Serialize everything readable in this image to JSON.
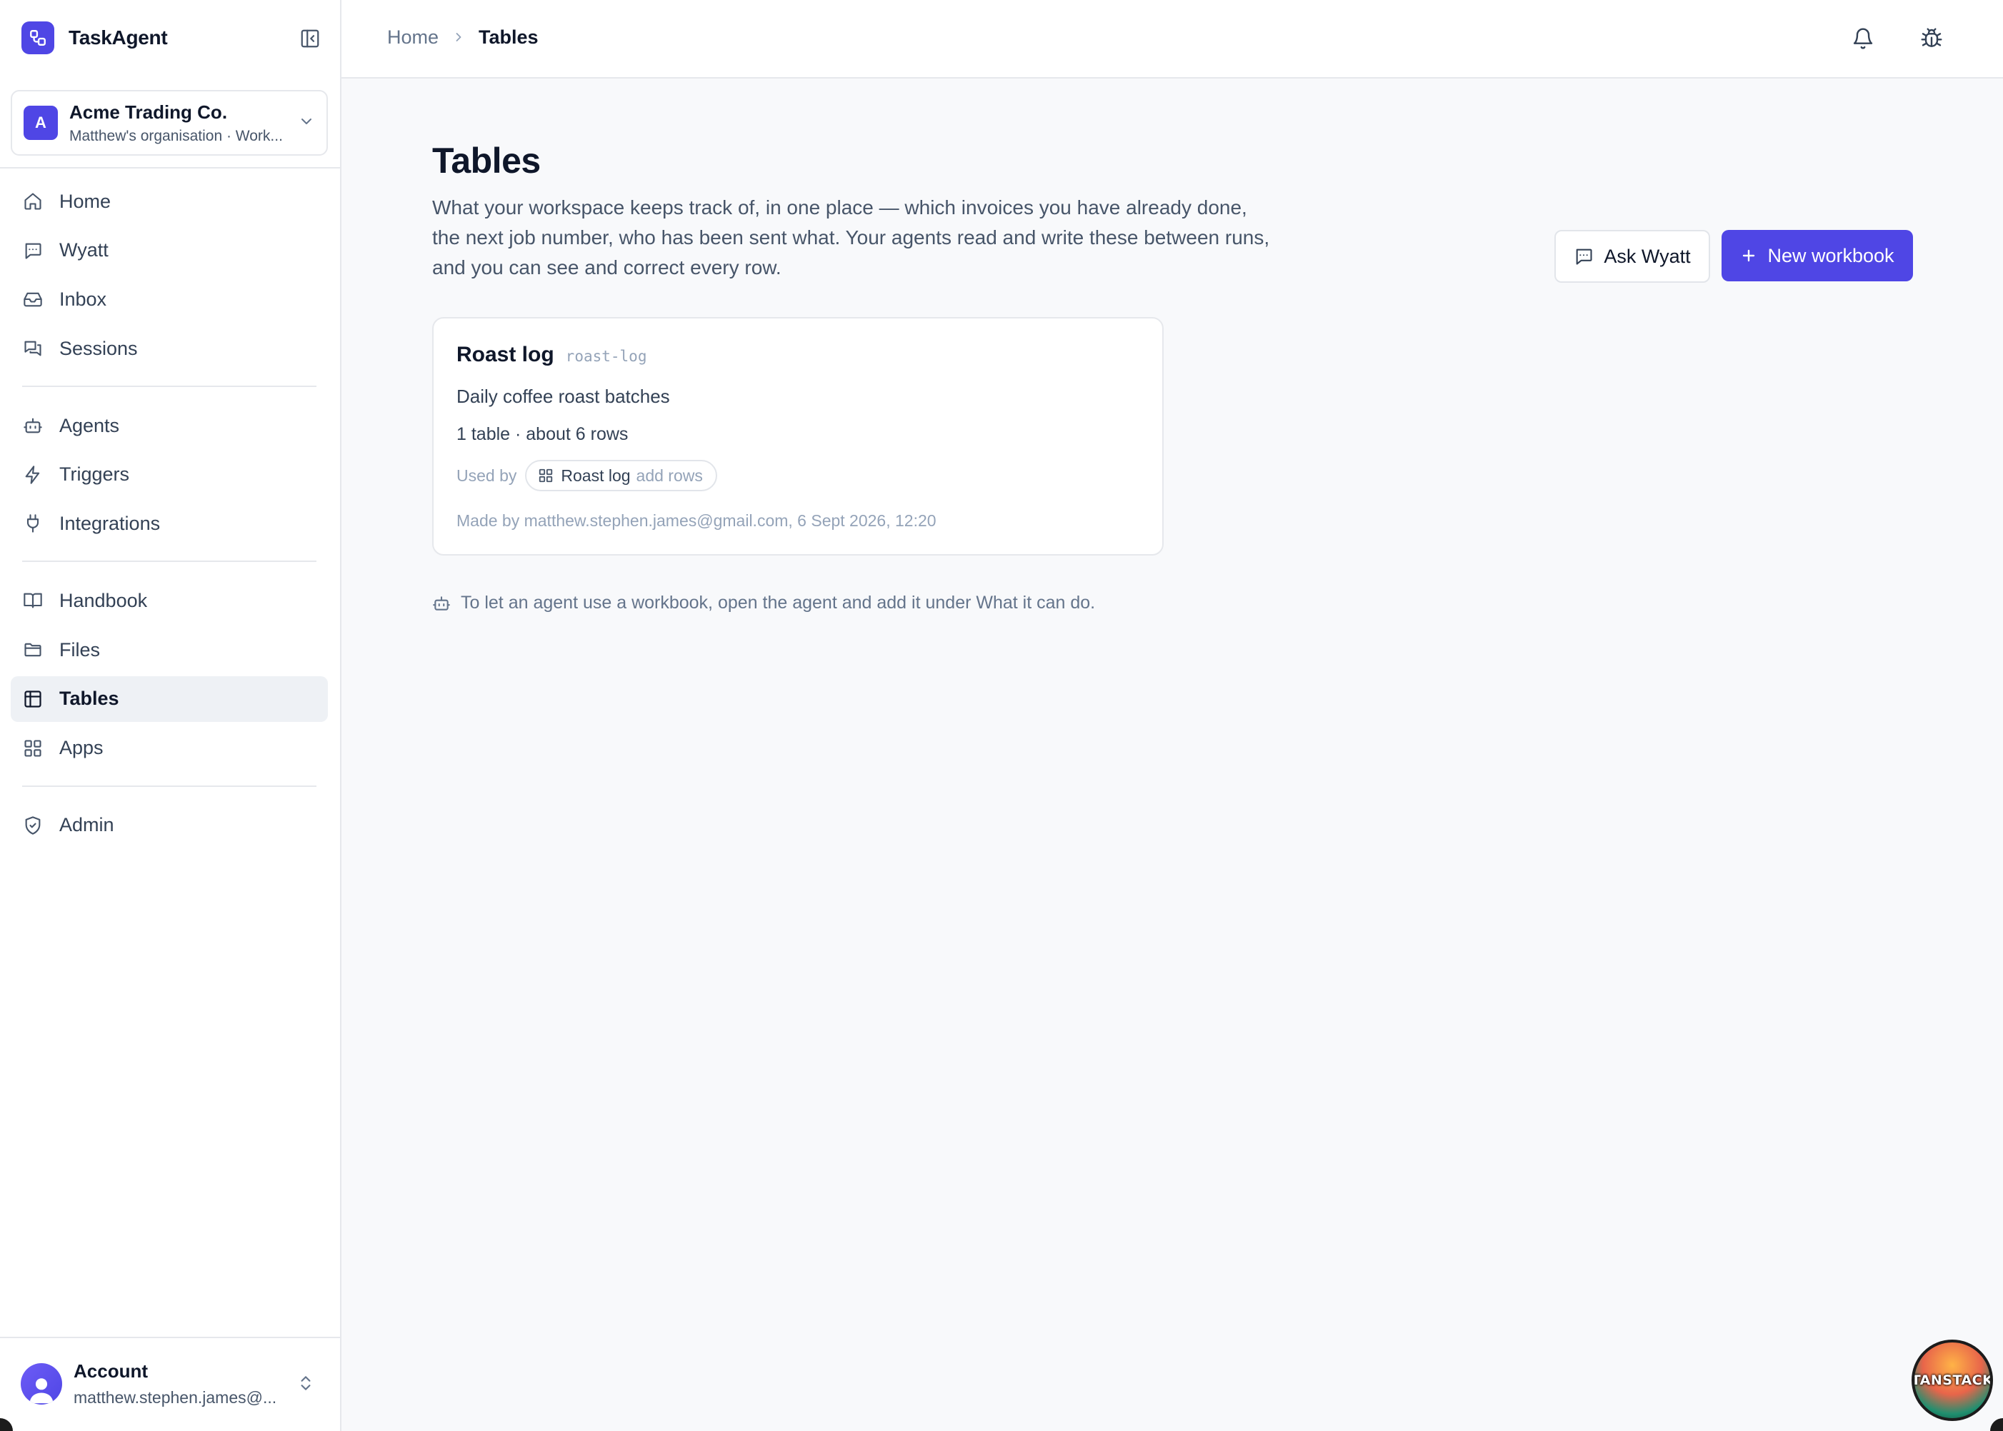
{
  "app": {
    "name": "TaskAgent"
  },
  "org": {
    "initial": "A",
    "name": "Acme Trading Co.",
    "subtitle": "Matthew's organisation · Work..."
  },
  "nav": {
    "groups": [
      [
        {
          "label": "Home",
          "icon": "home-icon"
        },
        {
          "label": "Wyatt",
          "icon": "chat-icon"
        },
        {
          "label": "Inbox",
          "icon": "inbox-icon"
        },
        {
          "label": "Sessions",
          "icon": "sessions-icon"
        }
      ],
      [
        {
          "label": "Agents",
          "icon": "robot-icon"
        },
        {
          "label": "Triggers",
          "icon": "bolt-icon"
        },
        {
          "label": "Integrations",
          "icon": "plug-icon"
        }
      ],
      [
        {
          "label": "Handbook",
          "icon": "book-icon"
        },
        {
          "label": "Files",
          "icon": "folder-icon"
        },
        {
          "label": "Tables",
          "icon": "table-icon",
          "active": true
        },
        {
          "label": "Apps",
          "icon": "grid-icon"
        }
      ],
      [
        {
          "label": "Admin",
          "icon": "shield-icon"
        }
      ]
    ]
  },
  "account": {
    "name": "Account",
    "email": "matthew.stephen.james@..."
  },
  "breadcrumb": {
    "home": "Home",
    "current": "Tables"
  },
  "page": {
    "title": "Tables",
    "description": "What your workspace keeps track of, in one place — which invoices you have already done, the next job number, who has been sent what. Your agents read and write these between runs, and you can see and correct every row.",
    "ask_button": "Ask Wyatt",
    "new_button": "New workbook",
    "hint": "To let an agent use a workbook, open the agent and add it under What it can do."
  },
  "workbook": {
    "title": "Roast log",
    "slug": "roast-log",
    "description": "Daily coffee roast batches",
    "meta": "1 table · about 6 rows",
    "used_by_label": "Used by",
    "used_by": {
      "name": "Roast log",
      "permission": "add rows"
    },
    "made_by": "Made by matthew.stephen.james@gmail.com, 6 Sept 2026, 12:20"
  },
  "devtools": {
    "label": "TANSTACK"
  },
  "colors": {
    "accent": "#4f46e5",
    "text": "#0f172a",
    "muted": "#64748b",
    "border": "#e6e8ec",
    "bg": "#f8f9fb"
  }
}
